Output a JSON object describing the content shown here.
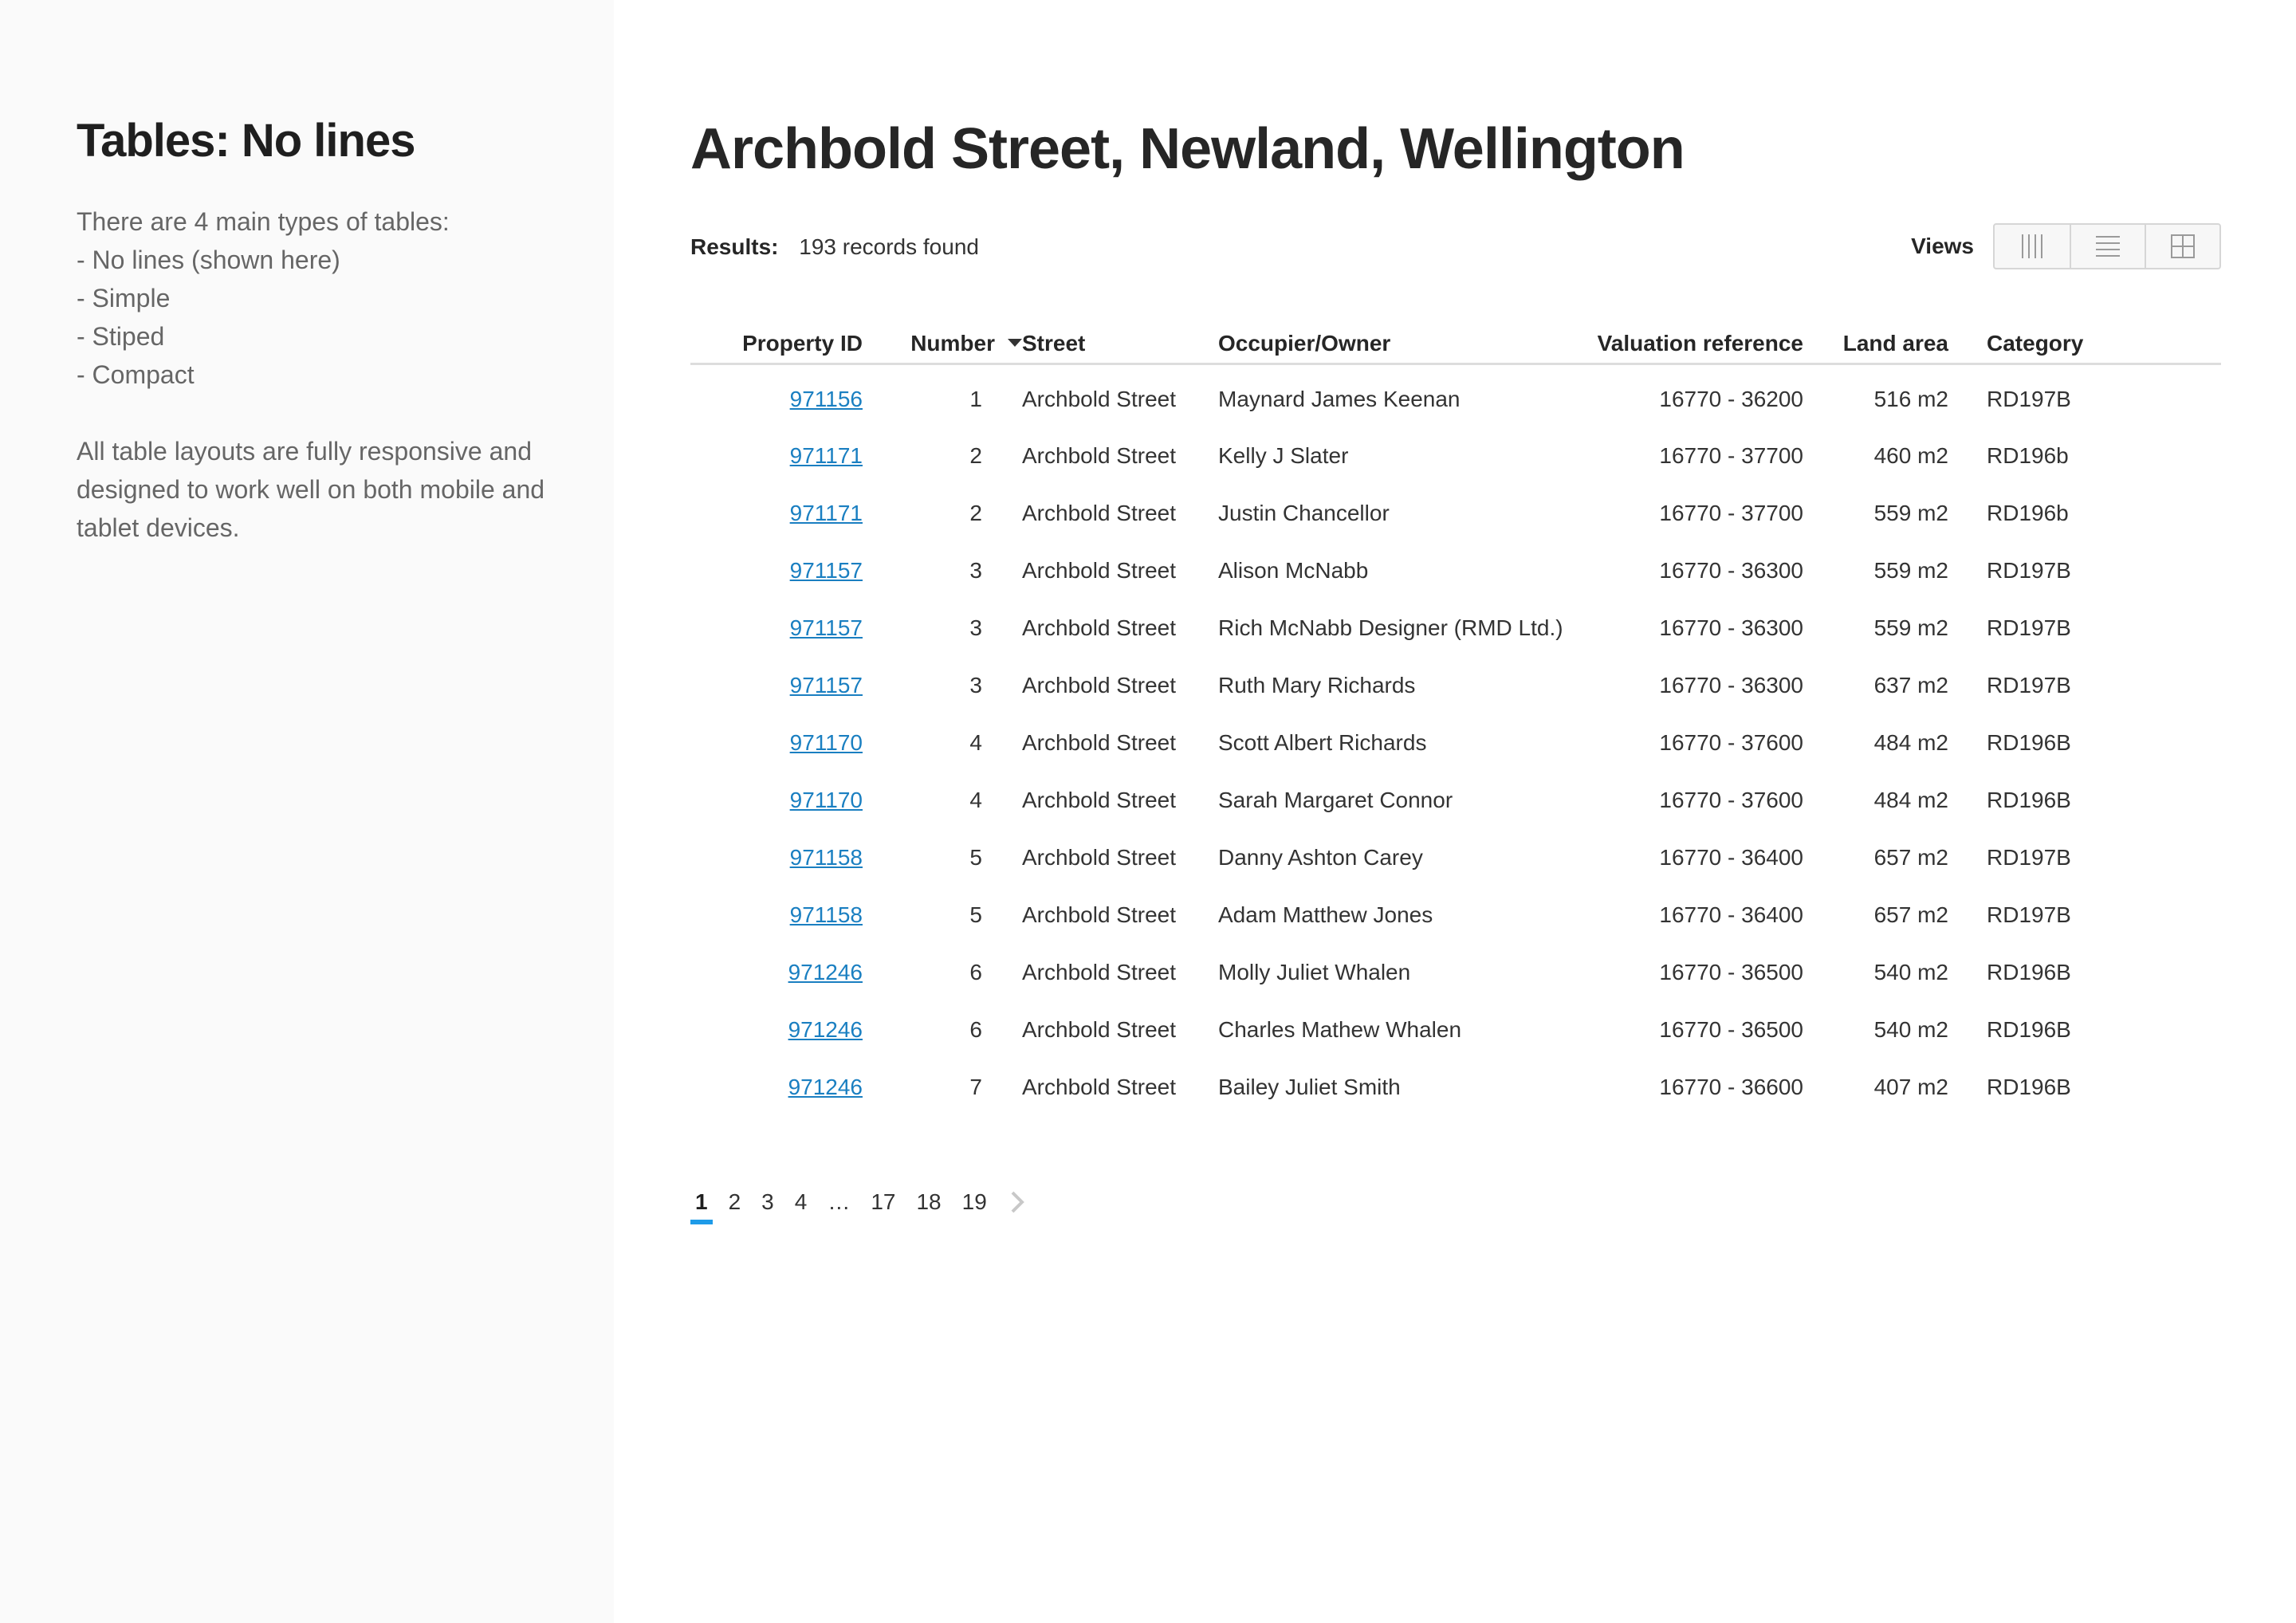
{
  "sidebar": {
    "title": "Tables: No lines",
    "intro_lines": [
      "There are 4 main types of tables:",
      "- No lines (shown here)",
      "- Simple",
      "- Stiped",
      "- Compact"
    ],
    "note": "All table layouts are fully responsive and designed to work well on both mobile and tablet devices."
  },
  "main": {
    "title": "Archbold Street, Newland, Wellington",
    "results_label": "Results:",
    "results_value": "193 records found",
    "views_label": "Views",
    "view_buttons": [
      "columns-view-icon",
      "list-view-icon",
      "grid-view-icon"
    ]
  },
  "table": {
    "headers": {
      "property_id": "Property ID",
      "number": "Number",
      "street": "Street",
      "occupier": "Occupier/Owner",
      "valuation": "Valuation reference",
      "land_area": "Land area",
      "category": "Category"
    },
    "sort_column": "number",
    "sort_direction": "descending-arrow",
    "rows": [
      [
        "971156",
        "1",
        "Archbold Street",
        "Maynard James Keenan",
        "16770 - 36200",
        "516 m2",
        "RD197B"
      ],
      [
        "971171",
        "2",
        "Archbold Street",
        "Kelly J Slater",
        "16770 - 37700",
        "460 m2",
        "RD196b"
      ],
      [
        "971171",
        "2",
        "Archbold Street",
        "Justin Chancellor",
        "16770 - 37700",
        "559 m2",
        "RD196b"
      ],
      [
        "971157",
        "3",
        "Archbold Street",
        "Alison McNabb",
        "16770 - 36300",
        "559 m2",
        "RD197B"
      ],
      [
        "971157",
        "3",
        "Archbold Street",
        "Rich McNabb Designer (RMD Ltd.)",
        "16770 - 36300",
        "559 m2",
        "RD197B"
      ],
      [
        "971157",
        "3",
        "Archbold Street",
        "Ruth Mary Richards",
        "16770 - 36300",
        "637 m2",
        "RD197B"
      ],
      [
        "971170",
        "4",
        "Archbold Street",
        "Scott Albert Richards",
        "16770 - 37600",
        "484 m2",
        "RD196B"
      ],
      [
        "971170",
        "4",
        "Archbold Street",
        "Sarah Margaret Connor",
        "16770 - 37600",
        "484 m2",
        "RD196B"
      ],
      [
        "971158",
        "5",
        "Archbold Street",
        "Danny Ashton Carey",
        "16770 - 36400",
        "657 m2",
        "RD197B"
      ],
      [
        "971158",
        "5",
        "Archbold Street",
        "Adam Matthew Jones",
        "16770 - 36400",
        "657 m2",
        "RD197B"
      ],
      [
        "971246",
        "6",
        "Archbold Street",
        "Molly Juliet Whalen",
        "16770 - 36500",
        "540 m2",
        "RD196B"
      ],
      [
        "971246",
        "6",
        "Archbold Street",
        "Charles Mathew Whalen",
        "16770 - 36500",
        "540 m2",
        "RD196B"
      ],
      [
        "971246",
        "7",
        "Archbold Street",
        "Bailey Juliet Smith",
        "16770 - 36600",
        "407 m2",
        "RD196B"
      ]
    ]
  },
  "pagination": {
    "pages": [
      "1",
      "2",
      "3",
      "4",
      "…",
      "17",
      "18",
      "19"
    ],
    "current": "1",
    "next_icon": "chevron-right-icon"
  },
  "colors": {
    "link": "#1a7fc1",
    "active_page_underline": "#1e9be8",
    "sidebar_bg": "#fafafa",
    "header_rule": "#dddddd"
  }
}
